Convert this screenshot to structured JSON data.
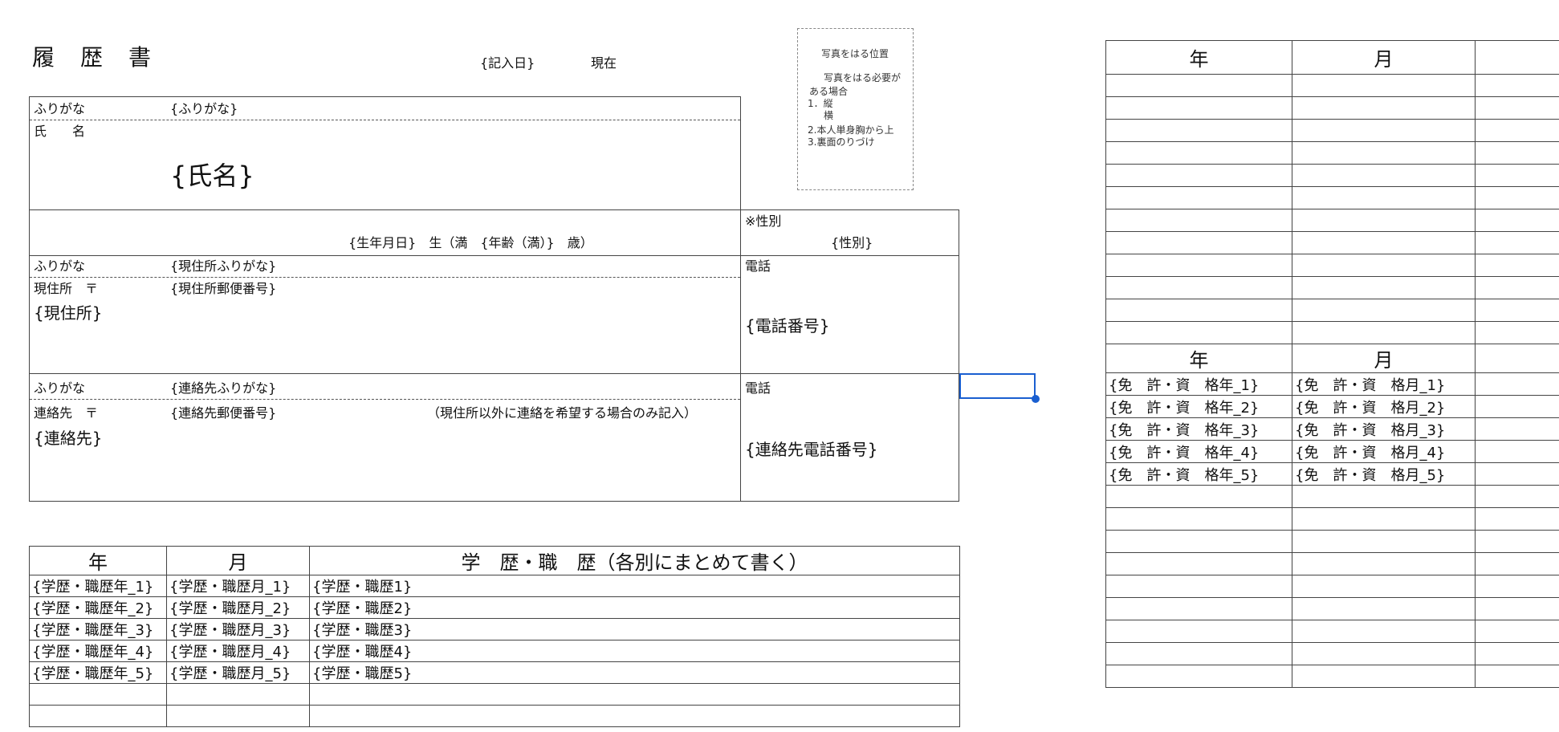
{
  "header": {
    "title": "履　歴　書",
    "date_placeholder": "{記入日}",
    "date_suffix": "現在"
  },
  "photo": {
    "title": "写真をはる位置",
    "note1": "写真をはる必要が",
    "note2": "ある場合",
    "item1": "1．縦",
    "item1b": "横",
    "item2": "2.本人単身胸から上",
    "item3": "3.裏面のりづけ"
  },
  "name_section": {
    "furigana_label": "ふりがな",
    "furigana_value": "{ふりがな}",
    "name_label": "氏　　名",
    "name_value": "{氏名}"
  },
  "birth_section": {
    "birth_text": "{生年月日}　生（満　{年齢（満）}　歳）",
    "gender_label": "※性別",
    "gender_value": "{性別}"
  },
  "address_section": {
    "furigana_label": "ふりがな",
    "furigana_value": "{現住所ふりがな}",
    "address_label": "現住所　〒",
    "postal_value": "{現住所郵便番号}",
    "address_value": "{現住所}",
    "phone_label": "電話",
    "phone_value": "{電話番号}"
  },
  "contact_section": {
    "furigana_label": "ふりがな",
    "furigana_value": "{連絡先ふりがな}",
    "contact_label": "連絡先　〒",
    "postal_value": "{連絡先郵便番号}",
    "note": "（現住所以外に連絡を希望する場合のみ記入）",
    "contact_value": "{連絡先}",
    "phone_label": "電話",
    "phone_value": "{連絡先電話番号}"
  },
  "history_table": {
    "headers": [
      "年",
      "月",
      "学　歴・職　歴（各別にまとめて書く）"
    ],
    "rows": [
      [
        "{学歴・職歴年_1}",
        "{学歴・職歴月_1}",
        "{学歴・職歴1}"
      ],
      [
        "{学歴・職歴年_2}",
        "{学歴・職歴月_2}",
        "{学歴・職歴2}"
      ],
      [
        "{学歴・職歴年_3}",
        "{学歴・職歴月_3}",
        "{学歴・職歴3}"
      ],
      [
        "{学歴・職歴年_4}",
        "{学歴・職歴月_4}",
        "{学歴・職歴4}"
      ],
      [
        "{学歴・職歴年_5}",
        "{学歴・職歴月_5}",
        "{学歴・職歴5}"
      ],
      [
        "",
        "",
        ""
      ],
      [
        "",
        "",
        ""
      ]
    ]
  },
  "right_table": {
    "headers": [
      "年",
      "月",
      ""
    ],
    "license_headers": [
      "年",
      "月",
      ""
    ],
    "license_rows": [
      [
        "{免　許・資　格年_1}",
        "{免　許・資　格月_1}",
        ""
      ],
      [
        "{免　許・資　格年_2}",
        "{免　許・資　格月_2}",
        ""
      ],
      [
        "{免　許・資　格年_3}",
        "{免　許・資　格月_3}",
        ""
      ],
      [
        "{免　許・資　格年_4}",
        "{免　許・資　格月_4}",
        ""
      ],
      [
        "{免　許・資　格年_5}",
        "{免　許・資　格月_5}",
        ""
      ]
    ]
  },
  "colors": {
    "selection": "#1a5fd0",
    "border": "#444444"
  }
}
